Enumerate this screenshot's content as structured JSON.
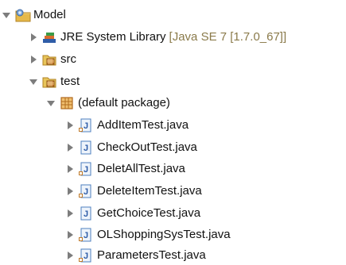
{
  "tree": {
    "project": {
      "label": "Model"
    },
    "jre": {
      "label": "JRE System Library",
      "decoration": "[Java SE 7 [1.7.0_67]]"
    },
    "src": {
      "label": "src"
    },
    "test": {
      "label": "test"
    },
    "package": {
      "label": "(default package)"
    },
    "files": [
      {
        "label": "AddItemTest.java"
      },
      {
        "label": "CheckOutTest.java"
      },
      {
        "label": "DeletAllTest.java"
      },
      {
        "label": "DeleteItemTest.java"
      },
      {
        "label": "GetChoiceTest.java"
      },
      {
        "label": "OLShoppingSysTest.java"
      },
      {
        "label": "ParametersTest.java"
      }
    ]
  }
}
